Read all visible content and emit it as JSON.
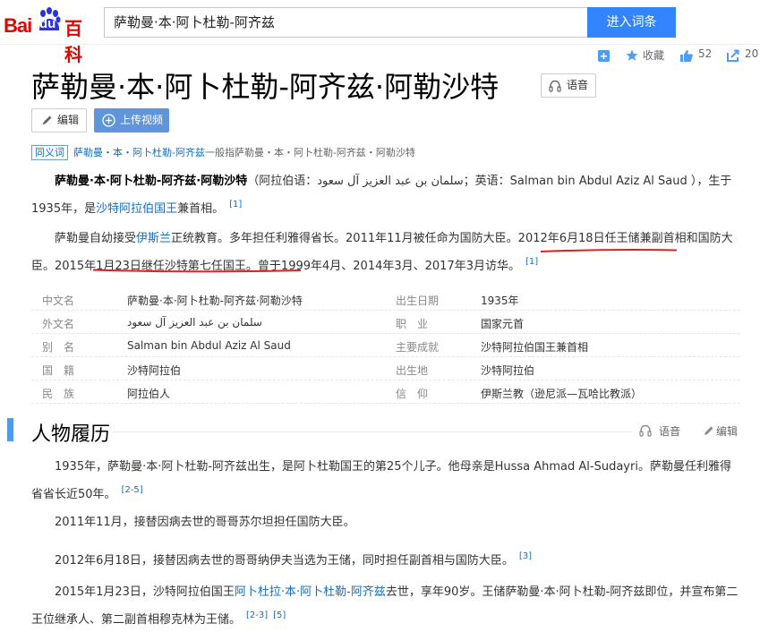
{
  "header": {
    "logo_bai": "Bai",
    "logo_du": "du",
    "logo_baike": "百科",
    "search_value": "萨勒曼·本·阿卜杜勒-阿齐兹",
    "search_button": "进入词条"
  },
  "actions": {
    "add_label": "",
    "favorite_label": "收藏",
    "like_count": "52",
    "share_count": "20"
  },
  "title": "萨勒曼·本·阿卜杜勒-阿齐兹·阿勒沙特",
  "voice_label": "语音",
  "edit_label": "编辑",
  "upload_label": "上传视频",
  "synonym": {
    "tag": "同义词",
    "link": "萨勒曼・本・阿卜杜勒-阿齐兹",
    "text": "一般指萨勒曼・本・阿卜杜勒-阿齐兹・阿勒沙特"
  },
  "intro": {
    "p1_bold": "萨勒曼·本·阿卜杜勒-阿齐兹·阿勒沙特",
    "p1_a": "（阿拉伯语：سلمان بن عبد العزيز آل سعود；英语：Salman bin Abdul Aziz Al Saud ），生于1935年，是",
    "p1_link": "沙特阿拉伯国王",
    "p1_b": "兼首相。",
    "p1_ref": "[1]",
    "p2_a": "萨勒曼自幼接受",
    "p2_link": "伊斯兰",
    "p2_b": "正统教育。多年担任利雅得省长。2011年11月被任命为国防大臣。",
    "p2_c": "2012年6月18日任王储",
    "p2_d": "兼副首相和国防大臣。",
    "p2_e": "2015年1月23日继任沙特第七任国王。",
    "p2_f": "曾于1999年4月、2014年3月、2017年3月访华。",
    "p2_ref": "[1]"
  },
  "info": [
    {
      "k1": "中文名",
      "v1": "萨勒曼·本·阿卜杜勒-阿齐兹·阿勒沙特",
      "v1_link": false,
      "k2": "出生日期",
      "v2": "1935年",
      "v2_link": false
    },
    {
      "k1": "外文名",
      "v1": "سلمان بن عبد العزيز آل سعود",
      "v1_link": false,
      "k2": "职　业",
      "v2": "国家元首",
      "v2_link": false
    },
    {
      "k1": "别　名",
      "v1": "Salman bin Abdul Aziz Al Saud",
      "v1_link": false,
      "k2": "主要成就",
      "v2": "沙特阿拉伯国王兼首相",
      "v2_link": true
    },
    {
      "k1": "国　籍",
      "v1": "沙特阿拉伯",
      "v1_link": true,
      "k2": "出生地",
      "v2": "沙特阿拉伯",
      "v2_link": false
    },
    {
      "k1": "民　族",
      "v1": "阿拉伯人",
      "v1_link": false,
      "k2": "信　仰",
      "v2": "伊斯兰教（逊尼派—瓦哈比教派）",
      "v2_link": true
    }
  ],
  "section": {
    "title": "人物履历",
    "voice": "语音",
    "edit": "编辑"
  },
  "history": {
    "p1": "1935年，萨勒曼·本·阿卜杜勒-阿齐兹出生，是阿卜杜勒国王的第25个儿子。他母亲是Hussa Ahmad Al-Sudayri。萨勒曼任利雅得省省长近50年。",
    "p1_ref": "[2-5]",
    "p2": "2011年11月，接替因病去世的哥哥苏尔坦担任国防大臣。",
    "p3": "2012年6月18日，接替因病去世的哥哥纳伊夫当选为王储，同时担任副首相与国防大臣。",
    "p3_ref": "[3]",
    "p4_a": "2015年1月23日，沙特阿拉伯国王",
    "p4_link": "阿卜杜拉·本·阿卜杜勒-阿齐兹",
    "p4_b": "去世，享年90岁。王储萨勒曼·本·阿卜杜勒-阿齐兹即位，并宣布第二王位继承人、第二副首相穆克林为王储。",
    "p4_ref1": "[2-3]",
    "p4_ref2": "[5]"
  },
  "colors": {
    "brand_red": "#e10601",
    "brand_blue": "#2932e1",
    "link_blue": "#136ec2",
    "button_blue": "#3385ff",
    "underline_red": "#e02020"
  }
}
